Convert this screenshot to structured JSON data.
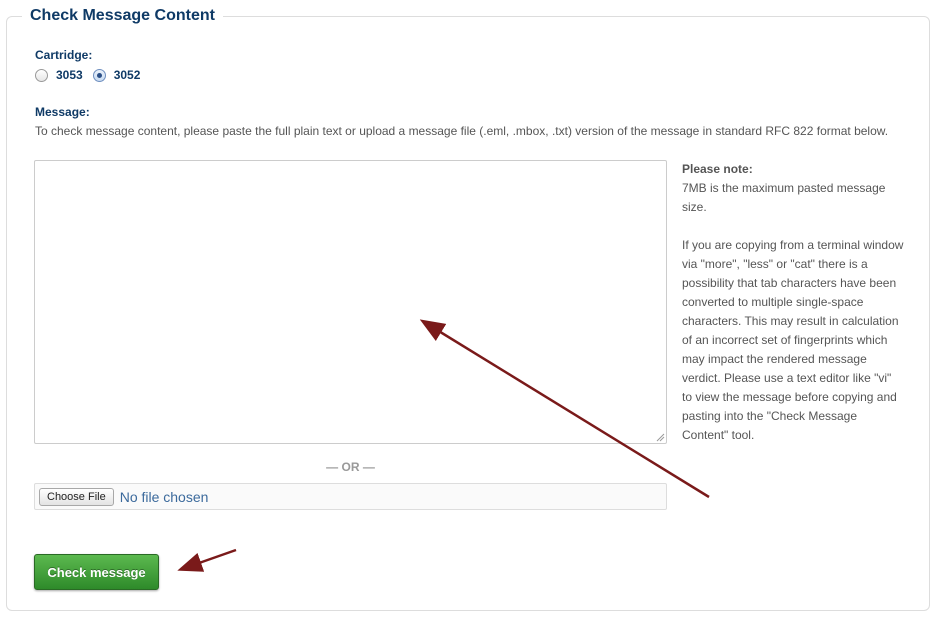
{
  "panel": {
    "title": "Check Message Content"
  },
  "cartridge": {
    "label": "Cartridge:",
    "options": [
      {
        "label": "3053",
        "checked": false
      },
      {
        "label": "3052",
        "checked": true
      }
    ]
  },
  "message": {
    "label": "Message:",
    "description": "To check message content, please paste the full plain text or upload a message file (.eml, .mbox, .txt) version of the message in standard RFC 822 format below.",
    "value": "",
    "placeholder": ""
  },
  "note": {
    "title": "Please note:",
    "paragraph1": "7MB is the maximum pasted message size.",
    "paragraph2": "If you are copying from a terminal window via \"more\", \"less\" or \"cat\" there is a possibility that tab characters have been converted to multiple single-space characters. This may result in calculation of an incorrect set of fingerprints which may impact the rendered message verdict. Please use a text editor like \"vi\" to view the message before copying and pasting into the \"Check Message Content\" tool."
  },
  "divider": {
    "text": "— OR —"
  },
  "file_upload": {
    "button_label": "Choose File",
    "status": "No file chosen"
  },
  "actions": {
    "submit_label": "Check message"
  },
  "colors": {
    "heading": "#0f3a66",
    "button_green": "#2e8a2a",
    "annotation_arrow": "#7a1a1a"
  }
}
